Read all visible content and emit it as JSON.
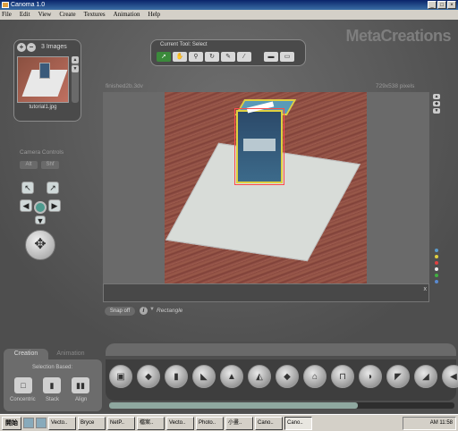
{
  "window": {
    "title": "Canoma 1.0",
    "buttons": [
      "_",
      "□",
      "×"
    ]
  },
  "menu": [
    "File",
    "Edit",
    "View",
    "Create",
    "Textures",
    "Animation",
    "Help"
  ],
  "brand": "MetaCreations",
  "images_panel": {
    "count_label": "3 Images",
    "file_name": "tutorial1.jpg",
    "add_icon": "+",
    "remove_icon": "−"
  },
  "camera": {
    "label": "Camera Controls",
    "tabs": [
      "Alt",
      "Shf"
    ]
  },
  "tools": {
    "label": "Current Tool: Select",
    "icons": [
      "pointer-icon",
      "hand-icon",
      "zoom-icon",
      "rotate-icon",
      "pin-icon",
      "pencil-icon",
      "camera-icon",
      "car-icon"
    ]
  },
  "document": {
    "title": "finished2b.3dv",
    "size": "729x538 pixels"
  },
  "status": {
    "close": "x",
    "snap_button": "Snap off",
    "info": "i",
    "shape_arrow": "▼",
    "shape_name": "Rectangle"
  },
  "right_dots": [
    "#5a9aca",
    "#e0d040",
    "#e04040",
    "#e8e8e8",
    "#40b040",
    "#5a8ad0"
  ],
  "bottom": {
    "tabs": [
      "Creation",
      "Animation"
    ],
    "selection_label": "Selection Based:",
    "modes": [
      {
        "label": "Concentric",
        "glyph": "□"
      },
      {
        "label": "Stack",
        "glyph": "▮"
      },
      {
        "label": "Align",
        "glyph": "▮▮"
      }
    ],
    "shapes": [
      "box",
      "table",
      "slab",
      "wedge",
      "pyramid",
      "pyramid-edge",
      "prism",
      "cylinder",
      "arch",
      "dome",
      "wedge-alt",
      "ramp",
      "wall",
      "corner"
    ],
    "progress": 0.72
  },
  "taskbar": {
    "start": "開始",
    "tasks": [
      "Vecto..",
      "Bryce",
      "NetP..",
      "檔案..",
      "Vecto..",
      "Photo..",
      "小畫..",
      "Cano..",
      "Cano.."
    ],
    "clock": "AM 11:58"
  }
}
